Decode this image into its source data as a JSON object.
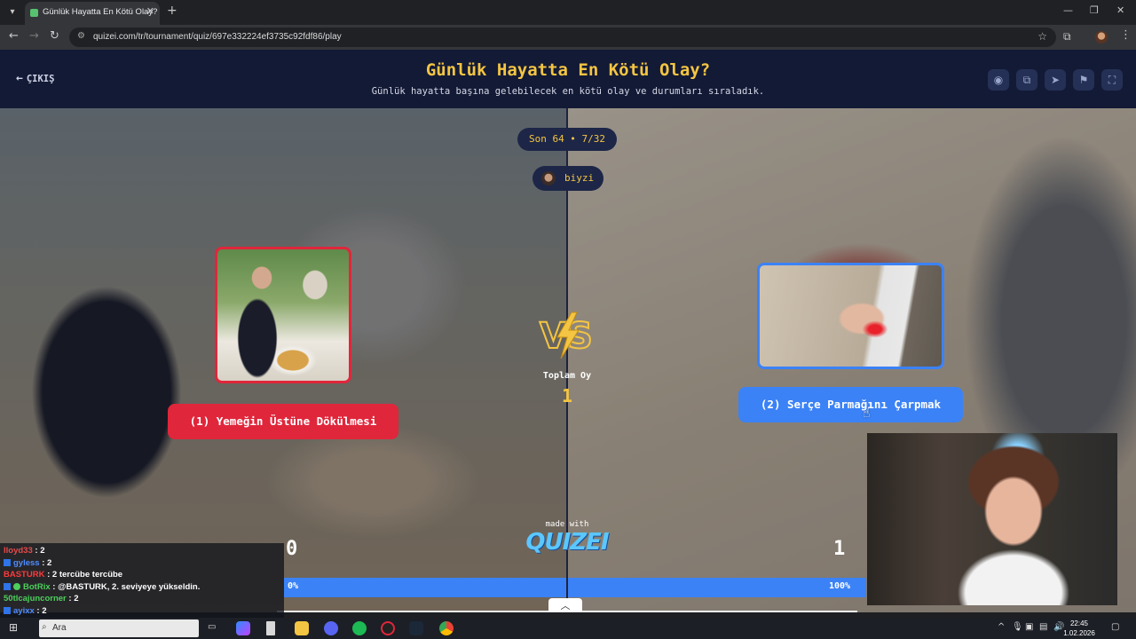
{
  "browser": {
    "tab_title": "Günlük Hayatta En Kötü Olay?",
    "url": "quizei.com/tr/tournament/quiz/697e332224ef3735c92fdf86/play"
  },
  "header": {
    "exit_label": "ÇIKIŞ",
    "title": "Günlük Hayatta En Kötü Olay?",
    "subtitle": "Günlük hayatta başına gelebilecek en kötü olay ve durumları sıraladık.",
    "actions": [
      "eye-icon",
      "copy-icon",
      "share-icon",
      "flag-icon",
      "fullscreen-icon"
    ]
  },
  "round": {
    "label": "Son 64 • 7/32"
  },
  "player": {
    "name": "biyzi"
  },
  "choices": {
    "left": {
      "label": "(1) Yemeğin Üstüne Dökülmesi",
      "color": "#e0263b"
    },
    "right": {
      "label": "(2) Serçe Parmağını Çarpmak",
      "color": "#3b82f6"
    }
  },
  "vs": {
    "total_label": "Toplam Oy",
    "total_value": "1"
  },
  "branding": {
    "made_with": "made with",
    "logo": "QUIZEI"
  },
  "scores": {
    "left": "0",
    "right": "1",
    "left_percent": "0%",
    "right_percent": "100%",
    "left_fraction": 0.0
  },
  "chat": [
    {
      "user": "lloyd33",
      "color": "#e84a4a",
      "badge": "none",
      "message": ": 2"
    },
    {
      "user": "gyless",
      "color": "#4f8cff",
      "badge": "square",
      "message": ": 2"
    },
    {
      "user": "BASTURK",
      "color": "#ff3a3a",
      "badge": "none",
      "message": ": 2 tercübe tercübe"
    },
    {
      "user": "BotRix",
      "color": "#4ccf5b",
      "badge": "both",
      "message": ": @BASTURK, 2. seviyeye yükseldin."
    },
    {
      "user": "50tlcajuncorner",
      "color": "#4ccf5b",
      "badge": "none",
      "message": ": 2"
    },
    {
      "user": "ayixx",
      "color": "#4f8cff",
      "badge": "square",
      "message": ": 2"
    }
  ],
  "taskbar": {
    "search_placeholder": "Ara",
    "time": "22:45",
    "date": "1.02.2026"
  },
  "colors": {
    "accent": "#f4c542",
    "header_bg": "#131a36",
    "red": "#e0263b",
    "blue": "#3b82f6"
  }
}
